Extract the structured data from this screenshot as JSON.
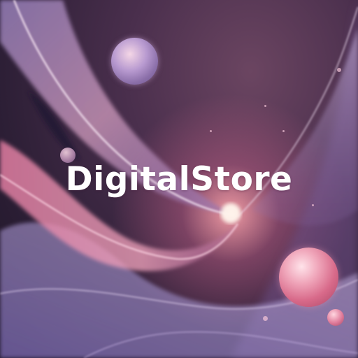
{
  "brand": {
    "title": "DigitalStore"
  },
  "theme": {
    "background": "#2d1f36",
    "accent_pink": "#e07c9b",
    "accent_lavender": "#b89ad0",
    "glow": "#ffe6dc",
    "text_color": "#ffffff"
  },
  "decorations": {
    "orbs": [
      "lavender-orb",
      "large-pink-orb",
      "small-pink-orb",
      "small-lavender-orb"
    ],
    "background": "flowing-silk-waves"
  }
}
